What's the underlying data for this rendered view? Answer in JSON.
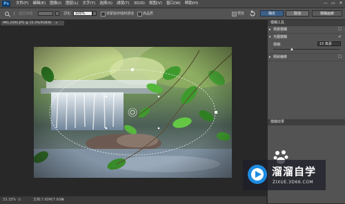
{
  "menu": {
    "logo": "Ps",
    "items": [
      "文件(F)",
      "编辑(E)",
      "图像(I)",
      "图层(L)",
      "文字(Y)",
      "选择(S)",
      "滤镜(T)",
      "3D(D)",
      "视图(V)",
      "窗口(W)",
      "帮助(H)"
    ],
    "controls": [
      "—",
      "▭",
      "✕"
    ]
  },
  "options": {
    "mode_label": "选区存储",
    "feather_label": "羽化:",
    "feather_value": "100%",
    "save_channel_label": "将蒙版存储到通道",
    "high_quality_label": "高品质",
    "preview_label": "预览",
    "ok_label": "确定",
    "cancel_label": "取消",
    "workspace_label": "模糊画廊"
  },
  "document": {
    "tab_title": "IMG_0392.JPG @ 33.3%(RGB/8)"
  },
  "status": {
    "zoom": "33.33%",
    "doc_info": "文档:7.60M/7.60M"
  },
  "panel": {
    "tools_header": "模糊工具",
    "field_blur": "场景模糊",
    "iris_blur": "光圈模糊",
    "blur_label": "模糊:",
    "blur_value": "15 像素",
    "tilt_shift": "倾斜偏移",
    "effects_header": "模糊效果"
  },
  "watermark": {
    "title": "溜溜自学",
    "url": "ZIXUE.3D66.COM"
  },
  "colors": {
    "accent": "#3c5f86",
    "watermark_blue": "#1d8be0"
  }
}
